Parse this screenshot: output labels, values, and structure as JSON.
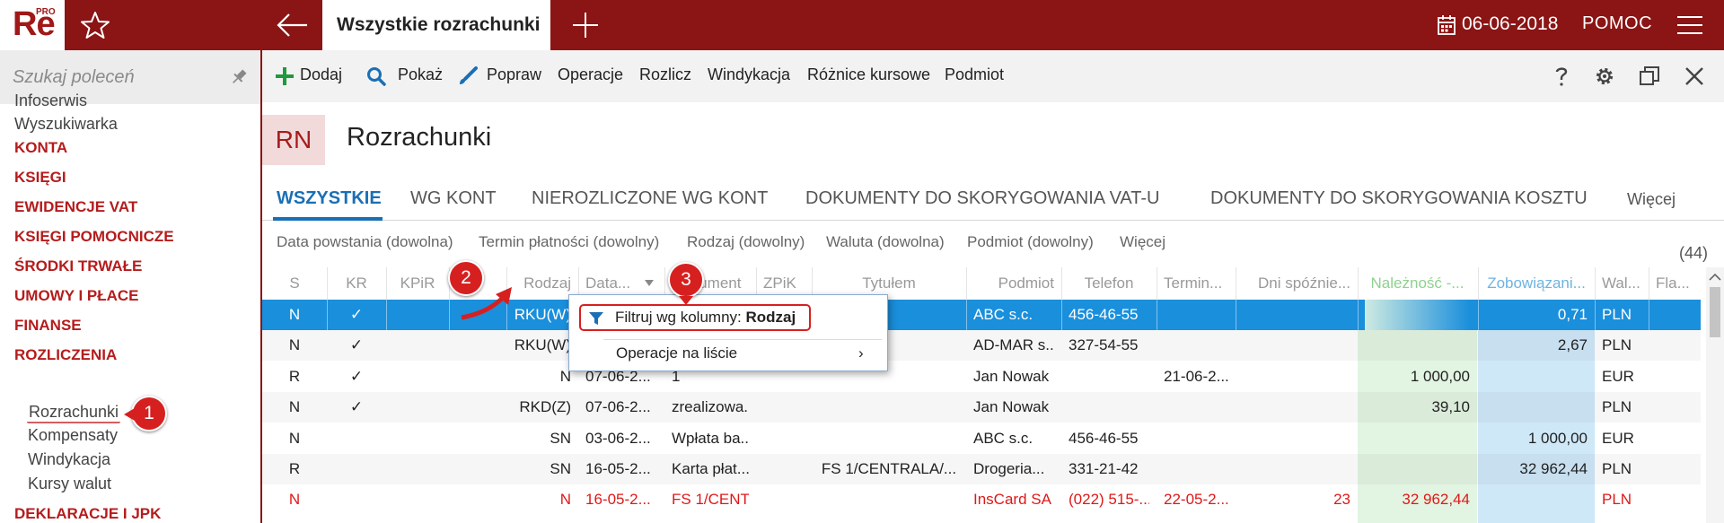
{
  "app": {
    "logo_text": "Re",
    "logo_sup": "PRO"
  },
  "topbar": {
    "active_tab": "Wszystkie rozrachunki",
    "date": "06-06-2018",
    "help": "POMOC"
  },
  "sidebar": {
    "search_placeholder": "Szukaj poleceń",
    "top_items": [
      "Infoserwis",
      "Wyszukiwarka"
    ],
    "sections": [
      "KONTA",
      "KSIĘGI",
      "EWIDENCJE VAT",
      "KSIĘGI POMOCNICZE",
      "ŚRODKI TRWAŁE",
      "UMOWY I PŁACE",
      "FINANSE",
      "ROZLICZENIA"
    ],
    "sub_items": [
      "Rozrachunki",
      "Kompensaty",
      "Windykacja",
      "Kursy walut"
    ],
    "last_section": "DEKLARACJE I JPK"
  },
  "toolbar": {
    "buttons": [
      "Dodaj",
      "Pokaż",
      "Popraw",
      "Operacje",
      "Rozlicz",
      "Windykacja",
      "Różnice kursowe",
      "Podmiot"
    ]
  },
  "header": {
    "code": "RN",
    "title": "Rozrachunki"
  },
  "tabs": [
    "WSZYSTKIE",
    "WG KONT",
    "NIEROZLICZONE WG KONT",
    "DOKUMENTY DO SKORYGOWANIA VAT-U",
    "DOKUMENTY DO SKORYGOWANIA KOSZTU",
    "Więcej"
  ],
  "filters": [
    "Data powstania (dowolna)",
    "Termin płatności (dowolny)",
    "Rodzaj (dowolny)",
    "Waluta (dowolna)",
    "Podmiot (dowolny)",
    "Więcej"
  ],
  "count": "(44)",
  "grid": {
    "columns": [
      "S",
      "KR",
      "KPiR",
      "",
      "Rodzaj",
      "Data...",
      "Dokument",
      "ZPiK",
      "Tytułem",
      "Podmiot",
      "Telefon",
      "Termin...",
      "Dni spóźnie...",
      "Należność -...",
      "Zobowiązani...",
      "Wal...",
      "Fla..."
    ],
    "rows": [
      [
        "N",
        "✓",
        "",
        "",
        "RKU(W)",
        "",
        "",
        "",
        "",
        "ABC s.c.",
        "456-46-55",
        "",
        "",
        "",
        "0,71",
        "PLN",
        ""
      ],
      [
        "N",
        "✓",
        "",
        "",
        "RKU(W)",
        "",
        "",
        "",
        "",
        "AD-MAR s...",
        "327-54-55",
        "",
        "",
        "",
        "2,67",
        "PLN",
        ""
      ],
      [
        "R",
        "✓",
        "",
        "",
        "N",
        "07-06-2...",
        "1",
        "",
        "",
        "Jan Nowak",
        "",
        "21-06-2...",
        "",
        "1 000,00",
        "",
        "EUR",
        ""
      ],
      [
        "N",
        "✓",
        "",
        "",
        "RKD(Z)",
        "07-06-2...",
        "zrealizowa...",
        "",
        "",
        "Jan Nowak",
        "",
        "",
        "",
        "39,10",
        "",
        "PLN",
        ""
      ],
      [
        "N",
        "",
        "",
        "",
        "SN",
        "03-06-2...",
        "Wpłata ba...",
        "",
        "",
        "ABC s.c.",
        "456-46-55",
        "",
        "",
        "",
        "1 000,00",
        "EUR",
        ""
      ],
      [
        "R",
        "",
        "",
        "",
        "SN",
        "16-05-2...",
        "Karta płat...",
        "",
        "FS 1/CENTRALA/...",
        "Drogeria...",
        "331-21-42",
        "",
        "",
        "",
        "32 962,44",
        "PLN",
        ""
      ],
      [
        "N",
        "",
        "",
        "",
        "N",
        "16-05-2...",
        "FS 1/CENT...",
        "",
        "",
        "InsCard SA",
        "(022) 515-...",
        "22-05-2...",
        "23",
        "32 962,44",
        "",
        "PLN",
        ""
      ]
    ],
    "selected_row": 0,
    "overdue_row": 6
  },
  "context_menu": {
    "filter_label": "Filtruj wg kolumny: ",
    "filter_column": "Rodzaj",
    "operations": "Operacje na liście",
    "arrow": "›"
  },
  "badges": [
    "1",
    "2",
    "3"
  ],
  "colors": {
    "brand": "#8b1414",
    "accent_blue": "#1a6fb5",
    "selected_row": "#1a8fdc",
    "receivable_col": "#e2f4e2",
    "liability_col": "#cfe8f8",
    "overdue_text": "#e01818",
    "badge": "#d62020"
  }
}
